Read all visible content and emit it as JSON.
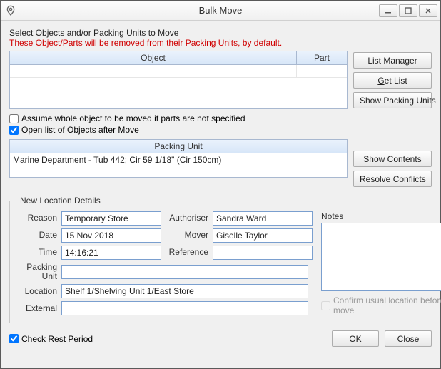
{
  "window": {
    "title": "Bulk Move"
  },
  "instructions": {
    "line1": "Select Objects and/or Packing Units to Move",
    "line2": "These Object/Parts will be removed from their Packing Units, by default."
  },
  "grid_objects": {
    "headers": {
      "object": "Object",
      "part": "Part"
    },
    "rows": [
      {
        "object": "",
        "part": ""
      }
    ]
  },
  "side_buttons_top": {
    "list_manager": "List Manager",
    "get_list": "Get List",
    "show_packing_units": "Show Packing Units"
  },
  "checkboxes": {
    "assume_whole": "Assume whole object to be moved if parts are not specified",
    "open_list_after": "Open list of Objects after Move",
    "check_rest_period": "Check Rest Period",
    "confirm_usual": "Confirm usual location before move"
  },
  "grid_packing": {
    "header": "Packing Unit",
    "rows": [
      "Marine Department - Tub 442; Cir 59 1/18\" (Cir 150cm)"
    ]
  },
  "side_buttons_mid": {
    "show_contents": "Show Contents",
    "resolve_conflicts": "Resolve Conflicts"
  },
  "details": {
    "legend": "New Location Details",
    "labels": {
      "reason": "Reason",
      "date": "Date",
      "time": "Time",
      "packing_unit": "Packing Unit",
      "location": "Location",
      "external": "External",
      "authoriser": "Authoriser",
      "mover": "Mover",
      "reference": "Reference",
      "notes": "Notes"
    },
    "values": {
      "reason": "Temporary Store",
      "date": "15 Nov 2018",
      "time": "14:16:21",
      "packing_unit": "",
      "location": "Shelf 1/Shelving Unit 1/East Store",
      "external": "",
      "authoriser": "Sandra Ward",
      "mover": "Giselle Taylor",
      "reference": "",
      "notes": ""
    }
  },
  "footer": {
    "ok": "OK",
    "close": "Close"
  }
}
